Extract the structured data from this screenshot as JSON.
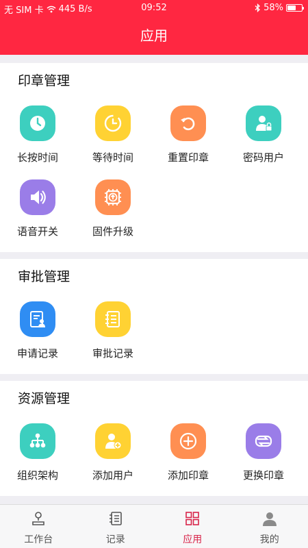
{
  "status_bar": {
    "carrier": "无 SIM 卡",
    "network_speed": "445 B/s",
    "time": "09:52",
    "battery_percent": "58%",
    "battery_level": 0.58
  },
  "nav": {
    "title": "应用"
  },
  "sections": [
    {
      "title": "印章管理",
      "items": [
        {
          "label": "长按时间",
          "icon": "clock-icon",
          "color": "#3dcfbf"
        },
        {
          "label": "等待时间",
          "icon": "timer-icon",
          "color": "#ffd233"
        },
        {
          "label": "重置印章",
          "icon": "reset-icon",
          "color": "#ff8f52"
        },
        {
          "label": "密码用户",
          "icon": "user-lock-icon",
          "color": "#3dcfbf"
        },
        {
          "label": "语音开关",
          "icon": "speaker-icon",
          "color": "#9a7de8"
        },
        {
          "label": "固件升级",
          "icon": "upgrade-chip-icon",
          "color": "#ff8f52"
        }
      ]
    },
    {
      "title": "审批管理",
      "items": [
        {
          "label": "申请记录",
          "icon": "application-record-icon",
          "color": "#2f8df3"
        },
        {
          "label": "审批记录",
          "icon": "approval-record-icon",
          "color": "#ffd233"
        }
      ]
    },
    {
      "title": "资源管理",
      "items": [
        {
          "label": "组织架构",
          "icon": "org-structure-icon",
          "color": "#3dcfbf"
        },
        {
          "label": "添加用户",
          "icon": "add-user-icon",
          "color": "#ffd233"
        },
        {
          "label": "添加印章",
          "icon": "add-seal-icon",
          "color": "#ff8f52"
        },
        {
          "label": "更换印章",
          "icon": "swap-seal-icon",
          "color": "#9a7de8"
        }
      ]
    }
  ],
  "tabbar": {
    "items": [
      {
        "label": "工作台",
        "icon": "workbench-icon",
        "active": false
      },
      {
        "label": "记录",
        "icon": "record-icon",
        "active": false
      },
      {
        "label": "应用",
        "icon": "apps-icon",
        "active": true
      },
      {
        "label": "我的",
        "icon": "profile-icon",
        "active": false
      }
    ],
    "active_color": "#d8244a",
    "inactive_color": "#555555"
  }
}
